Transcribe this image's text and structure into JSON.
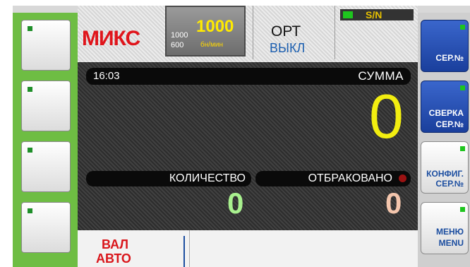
{
  "header": {
    "mode": "МИКС",
    "speed_value": "1000",
    "speed_options": [
      "1000",
      "600"
    ],
    "speed_unit": "бн/мин",
    "orient_label": "ОРТ",
    "orient_state": "ВЫКЛ",
    "serial_indicator": "S/N"
  },
  "main": {
    "time": "16:03",
    "sum_label": "СУММА",
    "sum_value": "0",
    "count_label": "КОЛИЧЕСТВО",
    "count_value": "0",
    "rejected_label": "ОТБРАКОВАНО",
    "rejected_value": "0"
  },
  "bottom": {
    "currency_line1": "ВАЛ",
    "currency_line2": "АВТО"
  },
  "right_buttons": [
    {
      "line1": "",
      "line2": "СЕР.№"
    },
    {
      "line1": "СВЕРКА",
      "line2": "СЕР.№"
    },
    {
      "line1": "КОНФИГ.",
      "line2": "СЕР.№"
    },
    {
      "line1": "МЕНЮ",
      "line2": "MENU"
    }
  ],
  "colors": {
    "mode": "#e0151b",
    "speed": "#ffea00",
    "sum": "#f2ee10",
    "count": "#a8f08e",
    "rejected": "#f4c6ad",
    "left_frame": "#6ebd43",
    "blue_button": "#1a3f9c"
  }
}
